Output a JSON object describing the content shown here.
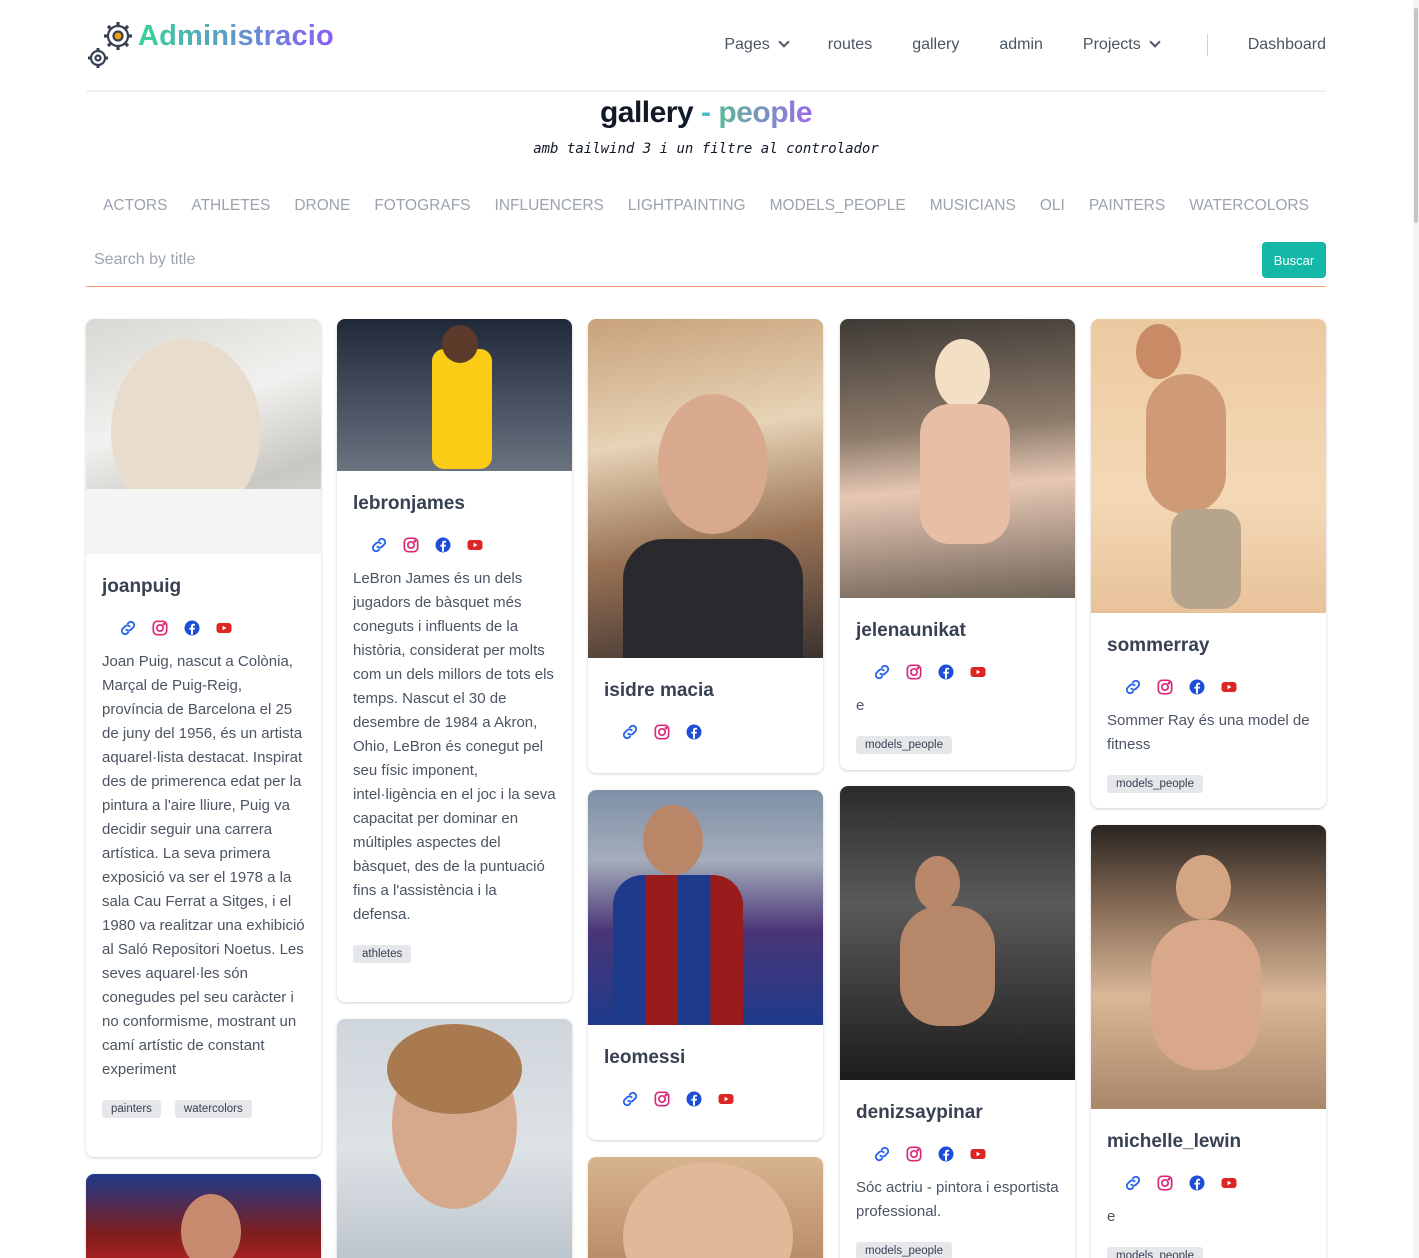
{
  "header": {
    "logo_text": "Administracio",
    "nav": [
      {
        "label": "Pages",
        "dropdown": true
      },
      {
        "label": "routes",
        "dropdown": false
      },
      {
        "label": "gallery",
        "dropdown": false
      },
      {
        "label": "admin",
        "dropdown": false
      },
      {
        "label": "Projects",
        "dropdown": true
      }
    ],
    "dashboard": "Dashboard"
  },
  "page": {
    "title_main": "gallery",
    "title_dash": "-",
    "title_sub": "people",
    "subtitle": "amb tailwind 3 i un filtre al controlador"
  },
  "categories": [
    "ACTORS",
    "ATHLETES",
    "DRONE",
    "FOTOGRAFS",
    "INFLUENCERS",
    "LIGHTPAINTING",
    "MODELS_PEOPLE",
    "MUSICIANS",
    "OLI",
    "PAINTERS",
    "WATERCOLORS"
  ],
  "search": {
    "placeholder": "Search by title",
    "button": "Buscar"
  },
  "colors": {
    "accent": "#14b8a6",
    "link_icon": "#2563eb",
    "instagram": "#db2777",
    "facebook": "#1d4ed8",
    "youtube": "#dc2626"
  },
  "cards": {
    "joanpuig": {
      "name": "joanpuig",
      "desc": "Joan Puig, nascut a Colònia, Marçal de Puig-Reig, província de Barcelona el 25 de juny del 1956, és un artista aquarel·lista destacat. Inspirat des de primerenca edat per la pintura a l'aire lliure, Puig va decidir seguir una carrera artística. La seva primera exposició va ser el 1978 a la sala Cau Ferrat a Sitges, i el 1980 va realitzar una exhibició al Saló Repositori Noetus. Les seves aquarel·les són conegudes pel seu caràcter i no conformisme, mostrant un camí artístic de constant experiment",
      "tags": [
        "painters",
        "watercolors"
      ]
    },
    "lebronjames": {
      "name": "lebronjames",
      "desc": "LeBron James és un dels jugadors de bàsquet més coneguts i influents de la història, considerat per molts com un dels millors de tots els temps. Nascut el 30 de desembre de 1984 a Akron, Ohio, LeBron és conegut pel seu físic imponent, intel·ligència en el joc i la seva capacitat per dominar en múltiples aspectes del bàsquet, des de la puntuació fins a l'assistència i la defensa.",
      "tags": [
        "athletes"
      ]
    },
    "isidremacia": {
      "name": "isidre macia"
    },
    "leomessi": {
      "name": "leomessi"
    },
    "jelenaunikat": {
      "name": "jelenaunikat",
      "desc": "e",
      "tags": [
        "models_people"
      ]
    },
    "denizsaypinar": {
      "name": "denizsaypinar",
      "desc": "Sóc actriu - pintora i esportista professional.",
      "tags": [
        "models_people"
      ]
    },
    "sommerray": {
      "name": "sommerray",
      "desc": "Sommer Ray és una model de fitness",
      "tags": [
        "models_people"
      ]
    },
    "michellelewin": {
      "name": "michelle_lewin",
      "desc": "e",
      "tags": [
        "models_people"
      ]
    }
  }
}
